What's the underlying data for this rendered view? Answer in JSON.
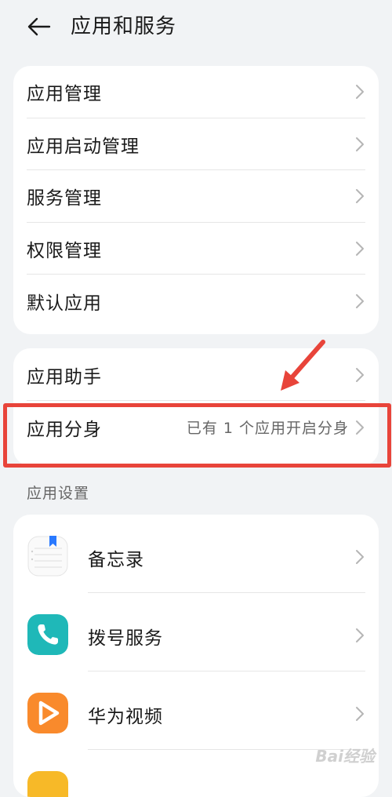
{
  "header": {
    "title": "应用和服务"
  },
  "group1": {
    "items": [
      {
        "label": "应用管理"
      },
      {
        "label": "应用启动管理"
      },
      {
        "label": "服务管理"
      },
      {
        "label": "权限管理"
      },
      {
        "label": "默认应用"
      }
    ]
  },
  "group2": {
    "items": [
      {
        "label": "应用助手"
      },
      {
        "label": "应用分身",
        "value": "已有 1 个应用开启分身"
      }
    ]
  },
  "app_settings": {
    "section_title": "应用设置",
    "apps": [
      {
        "label": "备忘录",
        "icon": "memo-icon"
      },
      {
        "label": "拨号服务",
        "icon": "phone-icon"
      },
      {
        "label": "华为视频",
        "icon": "video-icon"
      }
    ]
  },
  "watermark": {
    "text": "Bai经验"
  },
  "colors": {
    "background": "#f1f3f5",
    "card": "#ffffff",
    "highlight": "#e8443a",
    "phone_icon": "#1fb8b8",
    "video_icon": "#f98a2c"
  }
}
